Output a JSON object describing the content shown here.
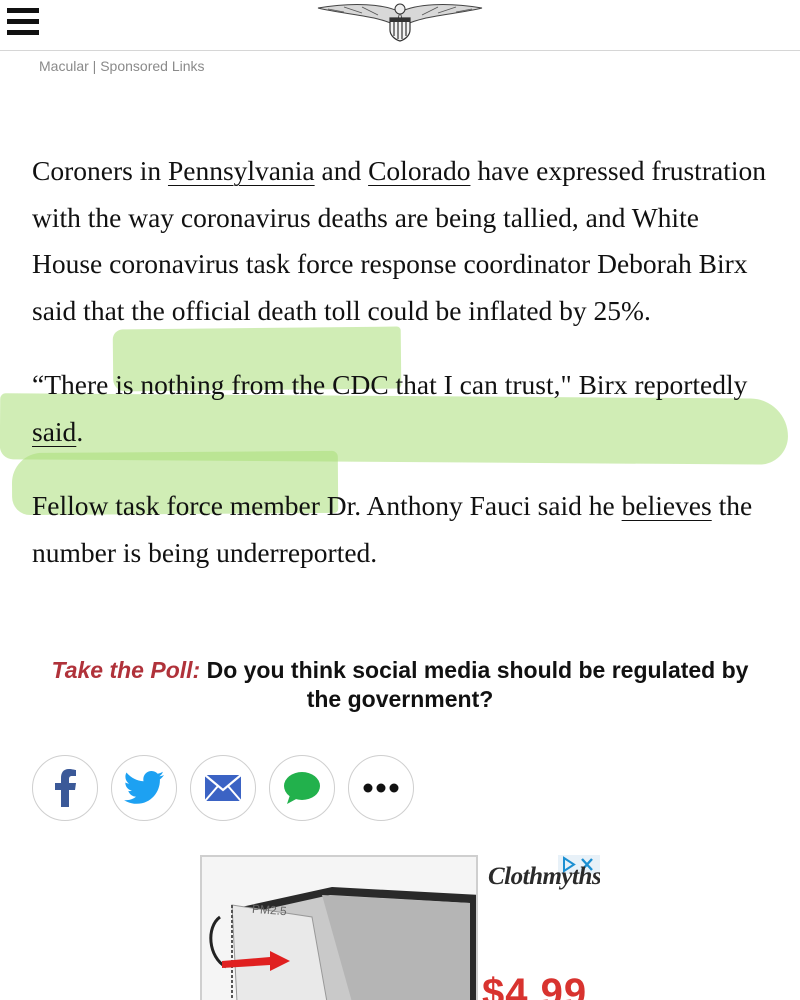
{
  "header": {
    "menu_icon": "hamburger-menu-icon",
    "logo_icon": "eagle-crest-logo"
  },
  "sponsored": {
    "text": "Macular | Sponsored Links"
  },
  "article": {
    "p1": {
      "t1": "Coroners in ",
      "link1": "Pennsylvania",
      "t2": " and ",
      "link2": "Colorado",
      "t3": " have expressed frustration with the way coronavirus deaths are being tallied, and White House coronavirus task force response coordinator Deborah Birx said that the official death toll could be inflated by 25%."
    },
    "p2": {
      "t1": "“There is nothing from the CDC that I can trust,\" Birx reportedly ",
      "link1": "said",
      "t2": "."
    },
    "p3": {
      "t1": "Fellow task force member Dr. Anthony Fauci said he ",
      "link1": "believes",
      "t2": " the number is being underreported."
    }
  },
  "poll": {
    "lead": "Take the Poll:",
    "question": " Do you think social media should be regulated by the government?"
  },
  "share": [
    {
      "icon": "facebook-icon"
    },
    {
      "icon": "twitter-icon"
    },
    {
      "icon": "email-icon"
    },
    {
      "icon": "message-icon"
    },
    {
      "icon": "more-icon"
    }
  ],
  "ad": {
    "brand": "Clothmyths",
    "image_label": "PM2.5",
    "price": "$4.99",
    "choices_icon": "adchoices-icon"
  },
  "colors": {
    "highlight": "#aade78",
    "poll_accent": "#b0323a",
    "facebook": "#3b5998",
    "twitter": "#1da1f2",
    "email": "#3b63c4",
    "message": "#22b14c",
    "ad_price": "#d8332f"
  }
}
